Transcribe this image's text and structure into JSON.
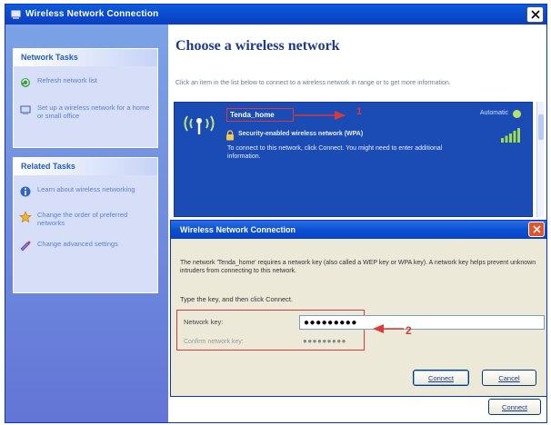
{
  "outer_window": {
    "title": "Wireless Network Connection"
  },
  "sidebar": {
    "panels": [
      {
        "title": "Network Tasks",
        "items": [
          {
            "label": "Refresh network list",
            "icon": "refresh-icon"
          },
          {
            "label": "Set up a wireless network for a home or small office",
            "icon": "setup-network-icon"
          }
        ]
      },
      {
        "title": "Related Tasks",
        "items": [
          {
            "label": "Learn about wireless networking",
            "icon": "info-icon"
          },
          {
            "label": "Change the order of preferred networks",
            "icon": "star-icon"
          },
          {
            "label": "Change advanced settings",
            "icon": "settings-icon"
          }
        ]
      }
    ]
  },
  "main": {
    "heading": "Choose a wireless network",
    "instruction": "Click an item in the list below to connect to a wireless network in range or to get more information.",
    "network": {
      "name": "Tenda_home",
      "status": "Automatic",
      "security": "Security-enabled wireless network (WPA)",
      "description": "To connect to this network, click Connect. You might need to enter additional information.",
      "callout": "1"
    },
    "connect_label": "Connect"
  },
  "dialog": {
    "title": "Wireless Network Connection",
    "message": "The network 'Tenda_home' requires a network key (also called a WEP key or WPA key). A network key helps prevent unknown intruders from connecting to this network.",
    "prompt": "Type the key, and then click Connect.",
    "key_label": "Network key:",
    "key_value": "●●●●●●●●●",
    "confirm_label": "Confirm network key:",
    "confirm_value": "●●●●●●●●●",
    "callout": "2",
    "connect_label": "Connect",
    "cancel_label": "Cancel"
  },
  "colors": {
    "accent": "#0a50d3",
    "highlight": "#d93a3a",
    "network_bg": "#1b4bb5"
  }
}
